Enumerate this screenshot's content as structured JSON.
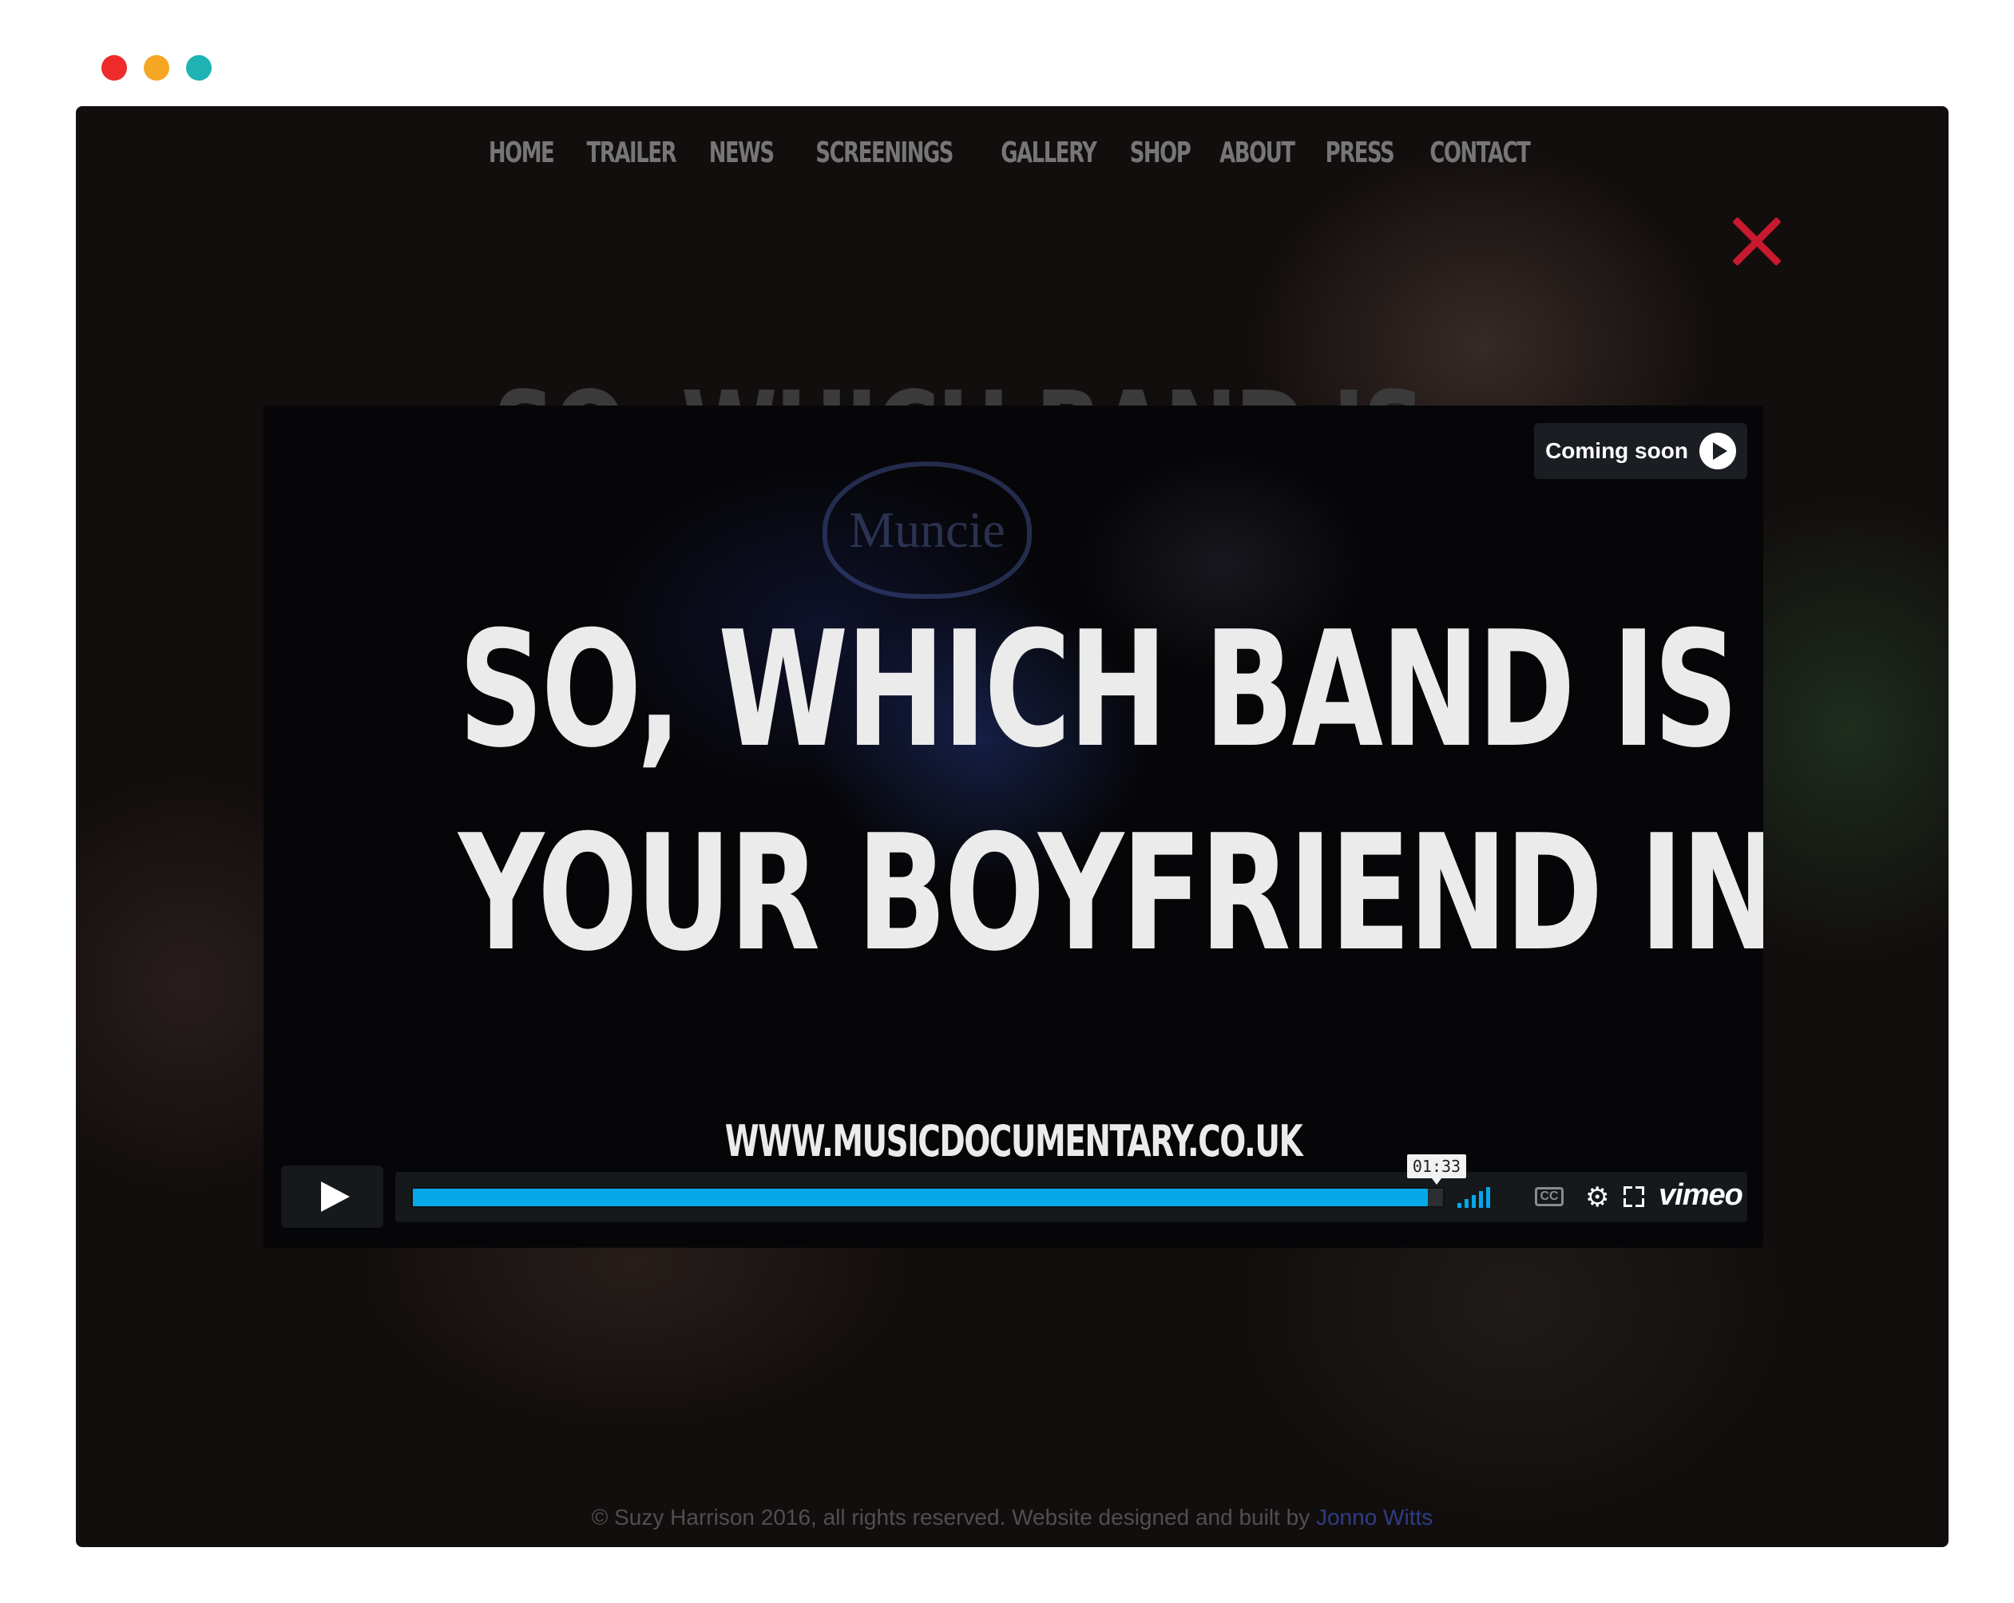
{
  "window_controls": {
    "colors": [
      "#ee2a2a",
      "#f5a623",
      "#1fb3b3"
    ]
  },
  "nav": {
    "items": [
      "HOME",
      "TRAILER",
      "NEWS",
      "SCREENINGS",
      "GALLERY",
      "SHOP",
      "ABOUT",
      "PRESS",
      "CONTACT"
    ]
  },
  "page": {
    "background_heading": "SO, WHICH BAND IS"
  },
  "player": {
    "band_logo_text": "Muncie",
    "line1": "SO, WHICH BAND IS",
    "line2": "YOUR BOYFRIEND IN?",
    "url": "WWW.MUSICDOCUMENTARY.CO.UK",
    "coming_soon": "Coming soon",
    "time": "01:33",
    "progress_fraction": 0.985,
    "cc_label": "CC",
    "brand": "vimeo",
    "accent_color": "#05a8e8"
  },
  "footer": {
    "text": "© Suzy Harrison 2016, all rights reserved. Website designed and built by ",
    "link": "Jonno Witts"
  },
  "close": {
    "color": "#c8192f"
  }
}
